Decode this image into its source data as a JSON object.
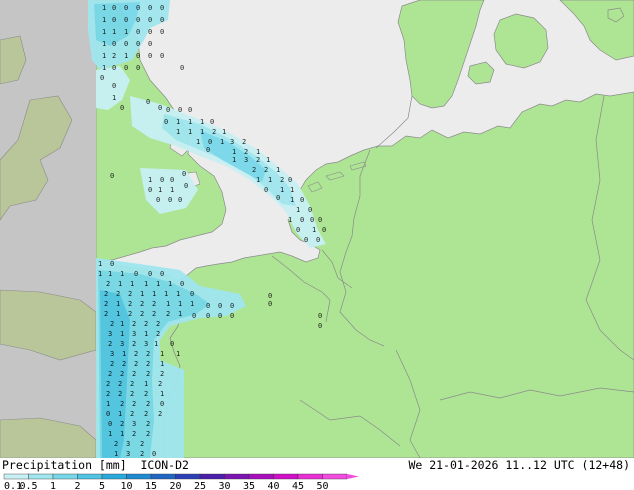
{
  "map": {
    "model": "ICON-D2",
    "field": "Precipitation [mm]",
    "land_color": "#aee595",
    "sea_color": "#ececec",
    "outside_domain_color": "#c5c5c5",
    "border_color": "#8a8a8a",
    "precip_colors": {
      "0.1-0.5": "#c8f0f4",
      "0.5-1": "#a0e6ef",
      "1-2": "#78d8ea",
      "2-5": "#50c4e4"
    },
    "point_values_note_glyphs": [
      "0",
      "1",
      "2",
      "3"
    ]
  },
  "footer": {
    "title": "Precipitation [mm]",
    "model": "ICON-D2",
    "datetime": "We 21-01-2026 11..12 UTC (12+48)"
  },
  "legend": {
    "labels": [
      "0.1",
      "0.5",
      "1",
      "2",
      "5",
      "10",
      "15",
      "20",
      "25",
      "30",
      "35",
      "40",
      "45",
      "50"
    ],
    "colors": [
      "#c8f0f4",
      "#a0e6ef",
      "#78d8ea",
      "#50c4e4",
      "#2aa9dc",
      "#1f8ad1",
      "#2266c4",
      "#2a40b4",
      "#4a1ea8",
      "#7b14b0",
      "#a70fbc",
      "#cf10c6",
      "#ea2fd6",
      "#f34ce0"
    ]
  }
}
